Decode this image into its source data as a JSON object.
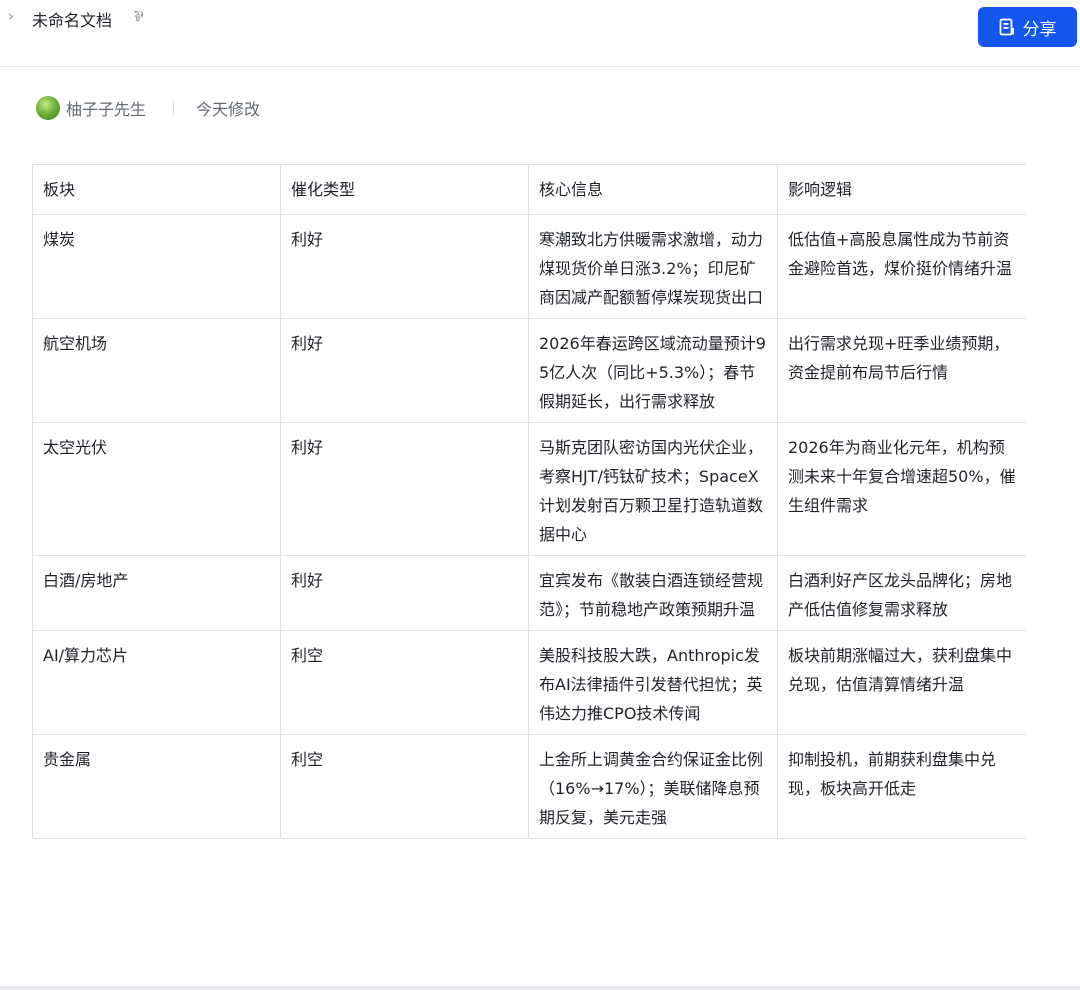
{
  "topbar": {
    "chevron": "›",
    "title": "未命名文档",
    "pin_glyph": "⅌",
    "share_label": "分享"
  },
  "meta": {
    "author": "柚子子先生",
    "modified": "今天修改"
  },
  "table": {
    "headers": [
      "板块",
      "催化类型",
      "核心信息",
      "影响逻辑"
    ],
    "rows": [
      [
        "煤炭",
        "利好",
        "寒潮致北方供暖需求激增，动力煤现货价单日涨3.2%；印尼矿商因减产配额暂停煤炭现货出口",
        "低估值+高股息属性成为节前资金避险首选，煤价挺价情绪升温"
      ],
      [
        "航空机场",
        "利好",
        "2026年春运跨区域流动量预计95亿人次（同比+5.3%）；春节假期延长，出行需求释放",
        "出行需求兑现+旺季业绩预期，资金提前布局节后行情"
      ],
      [
        "太空光伏",
        "利好",
        "马斯克团队密访国内光伏企业，考察HJT/钙钛矿技术；SpaceX计划发射百万颗卫星打造轨道数据中心",
        "2026年为商业化元年，机构预测未来十年复合增速超50%，催生组件需求"
      ],
      [
        "白酒/房地产",
        "利好",
        "宜宾发布《散装白酒连锁经营规范》；节前稳地产政策预期升温",
        "白酒利好产区龙头品牌化；房地产低估值修复需求释放"
      ],
      [
        "AI/算力芯片",
        "利空",
        "美股科技股大跌，Anthropic发布AI法律插件引发替代担忧；英伟达力推CPO技术传闻",
        "板块前期涨幅过大，获利盘集中兑现，估值清算情绪升温"
      ],
      [
        "贵金属",
        "利空",
        "上金所上调黄金合约保证金比例（16%→17%）；美联储降息预期反复，美元走强",
        "抑制投机，前期获利盘集中兑现，板块高开低走"
      ]
    ]
  }
}
